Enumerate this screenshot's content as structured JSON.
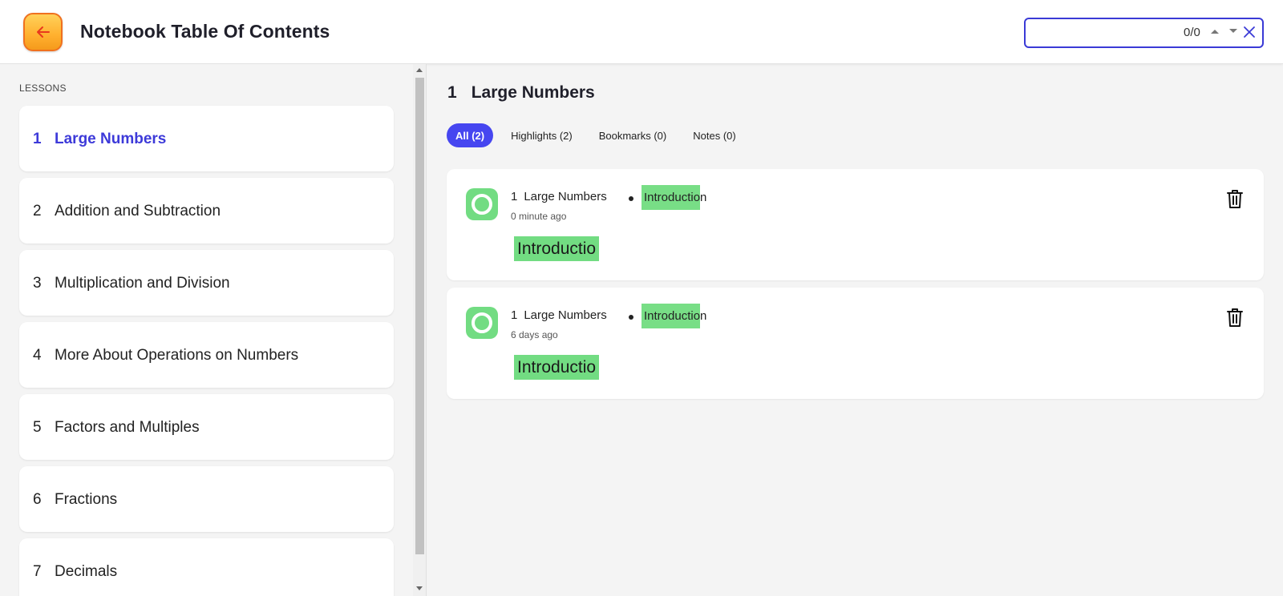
{
  "header": {
    "title": "Notebook Table Of Contents",
    "search": {
      "value": "",
      "placeholder": "",
      "count": "0/0"
    },
    "colors": {
      "back_button": "#ffb02e",
      "search_border": "#3a3ad6"
    }
  },
  "sidebar": {
    "heading": "LESSONS",
    "lessons": [
      {
        "num": "1",
        "label": "Large Numbers",
        "active": true
      },
      {
        "num": "2",
        "label": "Addition and Subtraction"
      },
      {
        "num": "3",
        "label": "Multiplication and Division"
      },
      {
        "num": "4",
        "label": "More About Operations on Numbers"
      },
      {
        "num": "5",
        "label": "Factors and Multiples"
      },
      {
        "num": "6",
        "label": "Fractions"
      },
      {
        "num": "7",
        "label": "Decimals"
      }
    ]
  },
  "main": {
    "title_num": "1",
    "title": "Large Numbers",
    "tabs": [
      {
        "label": "All (2)",
        "active": true
      },
      {
        "label": "Highlights (2)"
      },
      {
        "label": "Bookmarks (0)"
      },
      {
        "label": "Notes (0)"
      }
    ],
    "notes": [
      {
        "lesson_num": "1",
        "lesson": "Large Numbers",
        "section_highlighted": "Introductio",
        "section_rest": "n",
        "time": "0 minute ago",
        "quote": "Introductio"
      },
      {
        "lesson_num": "1",
        "lesson": "Large Numbers",
        "section_highlighted": "Introductio",
        "section_rest": "n",
        "time": "6 days ago",
        "quote": "Introductio"
      }
    ],
    "colors": {
      "accent": "#4646f0",
      "highlight": "#72dc82"
    }
  }
}
